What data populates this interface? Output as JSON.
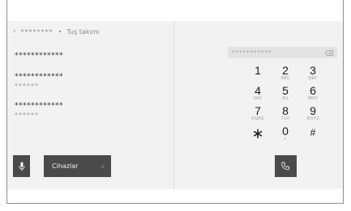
{
  "header": {
    "back_icon": "chevron-left-icon",
    "title_masked": "********",
    "separator": "•",
    "breadcrumb": "Tuş takımı"
  },
  "contacts": [
    {
      "name": "************",
      "sub": ""
    },
    {
      "name": "************",
      "sub": "******"
    },
    {
      "name": "************",
      "sub": "******"
    }
  ],
  "bottom_left": {
    "mic_icon": "microphone-icon",
    "devices_label": "Cihazlar"
  },
  "dialer": {
    "number_value": "***********",
    "backspace_icon": "backspace-icon",
    "keys": [
      {
        "digit": "1",
        "letters": ""
      },
      {
        "digit": "2",
        "letters": "ABC"
      },
      {
        "digit": "3",
        "letters": "DEF"
      },
      {
        "digit": "4",
        "letters": "GHI"
      },
      {
        "digit": "5",
        "letters": "JKL"
      },
      {
        "digit": "6",
        "letters": "MNO"
      },
      {
        "digit": "7",
        "letters": "PQRS"
      },
      {
        "digit": "8",
        "letters": "TUV"
      },
      {
        "digit": "9",
        "letters": "WXYZ"
      },
      {
        "digit": "∗",
        "letters": ""
      },
      {
        "digit": "0",
        "letters": "+"
      },
      {
        "digit": "#",
        "letters": ""
      }
    ],
    "call_icon": "phone-icon"
  },
  "colors": {
    "screen_bg": "#f2f2f2",
    "button_bg": "#4a4a4a",
    "frame_border": "#8c8c8c"
  }
}
